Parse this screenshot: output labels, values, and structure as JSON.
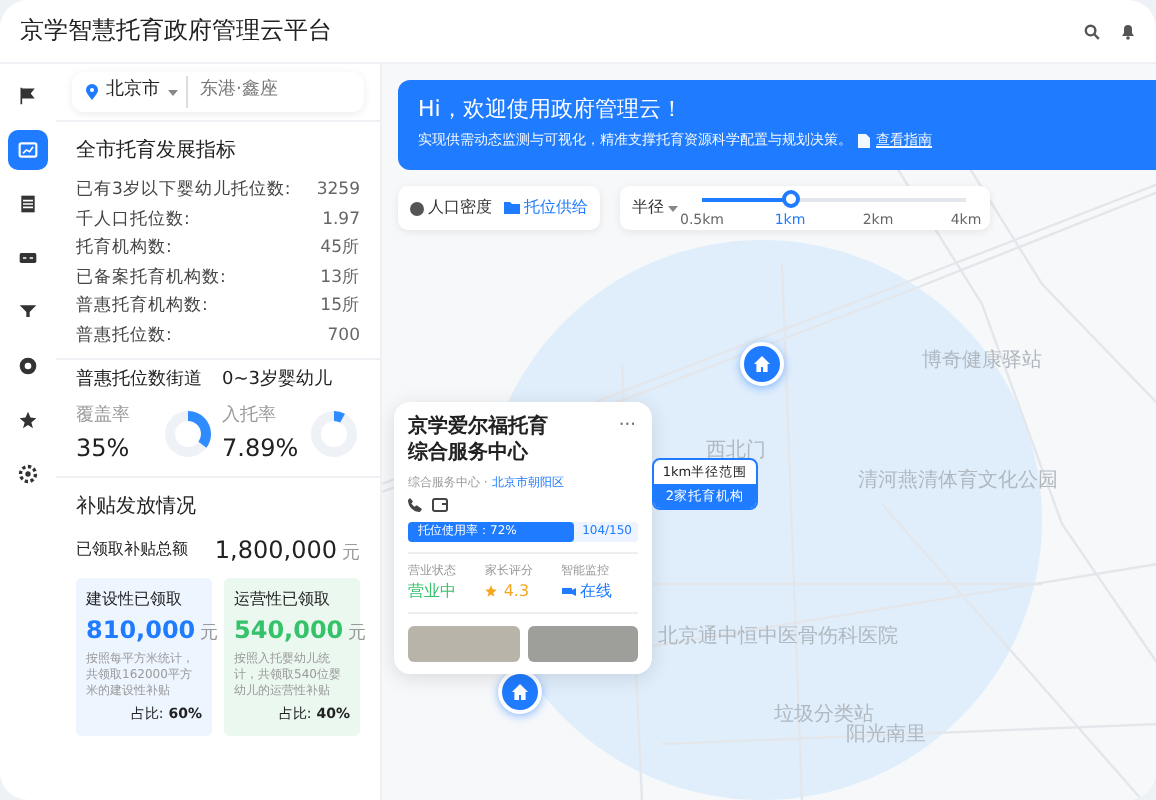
{
  "header": {
    "title": "京学智慧托育政府管理云平台"
  },
  "sidebar": {
    "items": [
      {
        "selected": false
      },
      {
        "selected": true
      },
      {
        "selected": false
      },
      {
        "selected": false
      },
      {
        "selected": false
      },
      {
        "selected": false
      },
      {
        "selected": false
      },
      {
        "selected": false
      }
    ]
  },
  "location": {
    "city": "北京市",
    "placeholder": "东港·鑫座"
  },
  "indicators": {
    "title": "全市托育发展指标",
    "rows": [
      {
        "label": "已有3岁以下婴幼儿托位数:",
        "value": "3259"
      },
      {
        "label": "千人口托位数:",
        "value": "1.97"
      },
      {
        "label": "托育机构数:",
        "value": "45所"
      },
      {
        "label": "已备案托育机构数:",
        "value": "13所"
      },
      {
        "label": "普惠托育机构数:",
        "value": "15所"
      },
      {
        "label": "普惠托位数:",
        "value": "700"
      }
    ]
  },
  "ratios": [
    {
      "title": "普惠托位数街道",
      "label": "覆盖率",
      "value": "35%",
      "level": 0.35
    },
    {
      "title": "0~3岁婴幼儿",
      "label": "入托率",
      "value": "7.89%",
      "level": 0.0789
    }
  ],
  "subsidy": {
    "title": "补贴发放情况",
    "total_label": "已领取补贴总额",
    "total": "1,800,000",
    "total_unit": "元",
    "boxes": [
      {
        "kind": "construction",
        "title": "建设性已领取",
        "amount": "810,000",
        "unit": "元",
        "note": "按照每平方米统计，共领取162000平方米的建设性补贴",
        "share_label": "占比:",
        "share": "60%"
      },
      {
        "kind": "operation",
        "title": "运营性已领取",
        "amount": "540,000",
        "unit": "元",
        "note": "按照入托婴幼儿统计，共领取540位婴幼儿的运营性补贴",
        "share_label": "占比:",
        "share": "40%"
      }
    ]
  },
  "banner": {
    "title": "Hi，欢迎使用政府管理云！",
    "text": "实现供需动态监测与可视化，精准支撑托育资源科学配置与规划决策。",
    "link": "查看指南"
  },
  "layers": [
    {
      "label": "人口密度",
      "selected": false
    },
    {
      "label": "托位供给",
      "selected": true
    }
  ],
  "radius": {
    "label": "半径",
    "level": 0.333,
    "ticks": [
      {
        "label": "0.5km",
        "selected": false
      },
      {
        "label": "1km",
        "selected": true
      },
      {
        "label": "2km",
        "selected": false
      },
      {
        "label": "4km",
        "selected": false
      }
    ]
  },
  "popup": {
    "title": "京学爱尔福托育综合服务中心",
    "menu": "···",
    "category": "综合服务中心",
    "separator": "·",
    "district": "北京市朝阳区",
    "usage": "托位使用率：72%",
    "level": 0.72,
    "count": "104/150",
    "stats": [
      {
        "kind": "status",
        "label": "营业状态",
        "value": "营业中"
      },
      {
        "kind": "rating",
        "label": "家长评分",
        "value": "4.3"
      },
      {
        "kind": "camera",
        "label": "智能监控",
        "value": "在线"
      }
    ]
  },
  "range_label": {
    "title": "1km半径范围",
    "count": "2家托育机构"
  },
  "map_labels": [
    "博奇健康驿站",
    "西北门",
    "清河燕清体育文化公园",
    "北京通中恒中医骨伤科医院",
    "垃圾分类站",
    "阳光南里"
  ]
}
